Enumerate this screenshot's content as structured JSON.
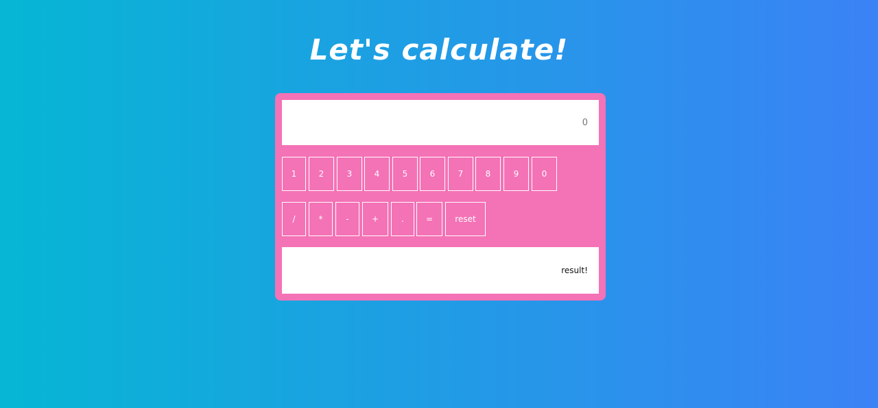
{
  "page": {
    "title": "Let's calculate!"
  },
  "display": {
    "placeholder": "0",
    "value": ""
  },
  "buttons": {
    "digits": [
      "1",
      "2",
      "3",
      "4",
      "5",
      "6",
      "7",
      "8",
      "9",
      "0"
    ],
    "operators": [
      "/",
      "*",
      "-",
      "+",
      ".",
      "=",
      "reset"
    ]
  },
  "result": {
    "text": "result!"
  },
  "colors": {
    "background_start": "#06b6d4",
    "background_end": "#3b82f6",
    "calculator": "#f472b6",
    "button_border": "#ffffff"
  }
}
